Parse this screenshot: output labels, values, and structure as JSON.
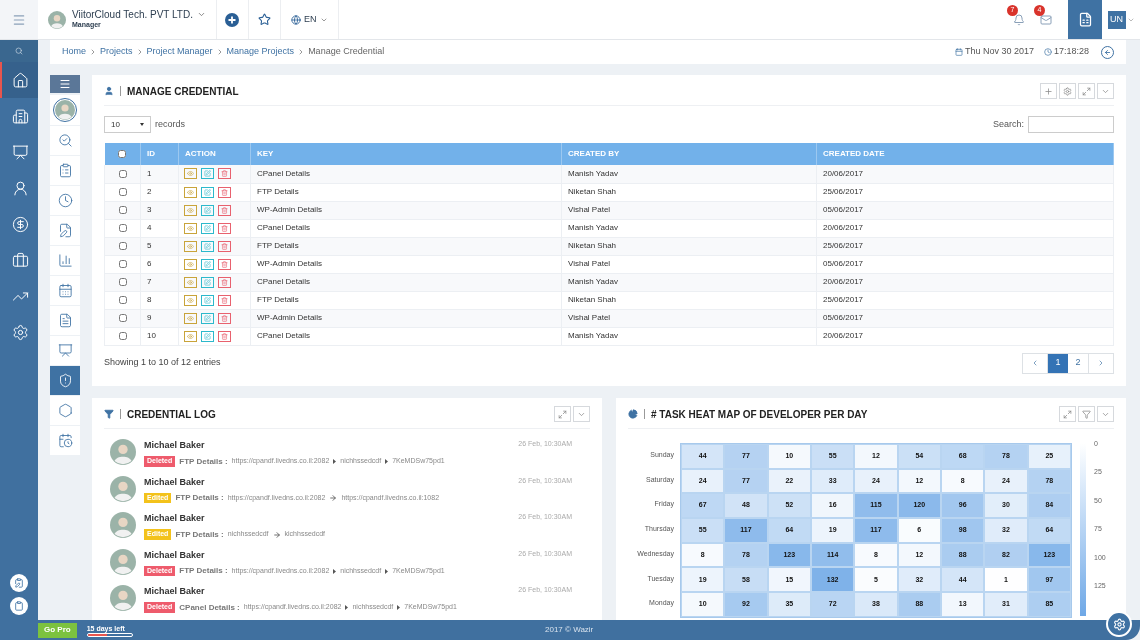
{
  "topbar": {
    "company": "ViitorCloud Tech. PVT LTD.",
    "role": "Manager",
    "language": "EN",
    "notifications": "7",
    "messages": "4",
    "user_initials": "UN"
  },
  "rail": {
    "items": [
      {
        "kind": "home",
        "selected": true
      },
      {
        "kind": "buildings",
        "selected": false
      },
      {
        "kind": "board",
        "selected": false
      },
      {
        "kind": "user",
        "selected": false
      },
      {
        "kind": "money",
        "selected": false
      },
      {
        "kind": "briefcase",
        "selected": false
      },
      {
        "kind": "chart",
        "selected": false
      },
      {
        "kind": "settings",
        "selected": false
      }
    ],
    "bottom_items": [
      {
        "kind": "clipboard-edit"
      },
      {
        "kind": "clipboard"
      }
    ]
  },
  "breadcrumb": {
    "items": [
      "Home",
      "Projects",
      "Project Manager",
      "Manage Projects",
      "Manage Credential"
    ],
    "date": "Thu Nov 30 2017",
    "time": "17:18:28"
  },
  "subnav": {
    "items": [
      {
        "kind": "search",
        "selected": false
      },
      {
        "kind": "clipboard",
        "selected": false
      },
      {
        "kind": "clock",
        "selected": false
      },
      {
        "kind": "file-edit",
        "selected": false
      },
      {
        "kind": "bars",
        "selected": false
      },
      {
        "kind": "calendar",
        "selected": false
      },
      {
        "kind": "file",
        "selected": false
      },
      {
        "kind": "dollar-board",
        "selected": false
      },
      {
        "kind": "shield",
        "selected": true
      },
      {
        "kind": "hexagons",
        "selected": false
      },
      {
        "kind": "calendar-clock",
        "selected": false
      }
    ]
  },
  "manage": {
    "title": "MANAGE CREDENTIAL",
    "page_size": "10",
    "records_label": "records",
    "search_label": "Search:",
    "columns": [
      "ID",
      "ACTION",
      "KEY",
      "CREATED BY",
      "CREATED DATE"
    ],
    "select_all_checked": false,
    "rows": [
      {
        "checked": false,
        "id": "1",
        "key": "CPanel Details",
        "created_by": "Manish Yadav",
        "created_date": "20/06/2017"
      },
      {
        "checked": false,
        "id": "2",
        "key": "FTP Details",
        "created_by": "Niketan Shah",
        "created_date": "25/06/2017"
      },
      {
        "checked": false,
        "id": "3",
        "key": "WP-Admin Details",
        "created_by": "Vishal Patel",
        "created_date": "05/06/2017"
      },
      {
        "checked": false,
        "id": "4",
        "key": "CPanel Details",
        "created_by": "Manish Yadav",
        "created_date": "20/06/2017"
      },
      {
        "checked": false,
        "id": "5",
        "key": "FTP Details",
        "created_by": "Niketan Shah",
        "created_date": "25/06/2017"
      },
      {
        "checked": false,
        "id": "6",
        "key": "WP-Admin Details",
        "created_by": "Vishal Patel",
        "created_date": "05/06/2017"
      },
      {
        "checked": false,
        "id": "7",
        "key": "CPanel Details",
        "created_by": "Manish Yadav",
        "created_date": "20/06/2017"
      },
      {
        "checked": false,
        "id": "8",
        "key": "FTP Details",
        "created_by": "Niketan Shah",
        "created_date": "25/06/2017"
      },
      {
        "checked": false,
        "id": "9",
        "key": "WP-Admin Details",
        "created_by": "Vishal Patel",
        "created_date": "05/06/2017"
      },
      {
        "checked": false,
        "id": "10",
        "key": "CPanel Details",
        "created_by": "Manish Yadav",
        "created_date": "20/06/2017"
      }
    ],
    "info": "Showing 1 to 10 of 12 entries",
    "pages": [
      {
        "label": "1",
        "selected": true
      },
      {
        "label": "2",
        "selected": false
      }
    ]
  },
  "log": {
    "title": "CREDENTIAL LOG",
    "entries": [
      {
        "name": "Michael Baker",
        "time": "26 Feb, 10:30AM",
        "kind": "deleted",
        "badge": "Deleted",
        "field": "FTP Details :",
        "values": [
          "https://cpandf.livedns.co.il:2082",
          "nichhssedcdf",
          "7KeMDSw75pd1"
        ]
      },
      {
        "name": "Michael Baker",
        "time": "26 Feb, 10:30AM",
        "kind": "edited",
        "badge": "Edited",
        "field": "FTP Details :",
        "values": [
          "https://cpandf.livedns.co.il:2082",
          "https://cpandf.livedns.co.il:1082"
        ]
      },
      {
        "name": "Michael Baker",
        "time": "26 Feb, 10:30AM",
        "kind": "edited",
        "badge": "Edited",
        "field": "FTP Details :",
        "values": [
          "nichhssedcdf",
          "kichhssedcdf"
        ]
      },
      {
        "name": "Michael Baker",
        "time": "26 Feb, 10:30AM",
        "kind": "deleted",
        "badge": "Deleted",
        "field": "FTP Details :",
        "values": [
          "https://cpandf.livedns.co.il:2082",
          "nichhssedcdf",
          "7KeMDSw75pd1"
        ]
      },
      {
        "name": "Michael Baker",
        "time": "26 Feb, 10:30AM",
        "kind": "deleted",
        "badge": "Deleted",
        "field": "CPanel Details :",
        "values": [
          "https://cpandf.livedns.co.il:2082",
          "nichhssedcdf",
          "7KeMDSw75pd1"
        ]
      }
    ]
  },
  "heatmap": {
    "title": "# TASK HEAT MAP OF DEVELOPER PER DAY",
    "rows": [
      {
        "label": "Sunday",
        "cells": [
          "44",
          "77",
          "10",
          "55",
          "12",
          "54",
          "68",
          "78",
          "25"
        ]
      },
      {
        "label": "Saturday",
        "cells": [
          "24",
          "77",
          "22",
          "33",
          "24",
          "12",
          "8",
          "24",
          "78"
        ]
      },
      {
        "label": "Friday",
        "cells": [
          "67",
          "48",
          "52",
          "16",
          "115",
          "120",
          "96",
          "30",
          "84"
        ]
      },
      {
        "label": "Thursday",
        "cells": [
          "55",
          "117",
          "64",
          "19",
          "117",
          "6",
          "98",
          "32",
          "64"
        ]
      },
      {
        "label": "Wednesday",
        "cells": [
          "8",
          "78",
          "123",
          "114",
          "8",
          "12",
          "88",
          "82",
          "123"
        ]
      },
      {
        "label": "Tuesday",
        "cells": [
          "19",
          "58",
          "15",
          "132",
          "5",
          "32",
          "44",
          "1",
          "97"
        ]
      },
      {
        "label": "Monday",
        "cells": [
          "10",
          "92",
          "35",
          "72",
          "38",
          "88",
          "13",
          "31",
          "85"
        ]
      }
    ],
    "scale": [
      "0",
      "25",
      "50",
      "75",
      "100",
      "125"
    ]
  },
  "footer": {
    "go_pro": "Go Pro",
    "trial": {
      "label": "15 days left",
      "level": 0.45
    },
    "copyright": "2017 © Wazir"
  }
}
